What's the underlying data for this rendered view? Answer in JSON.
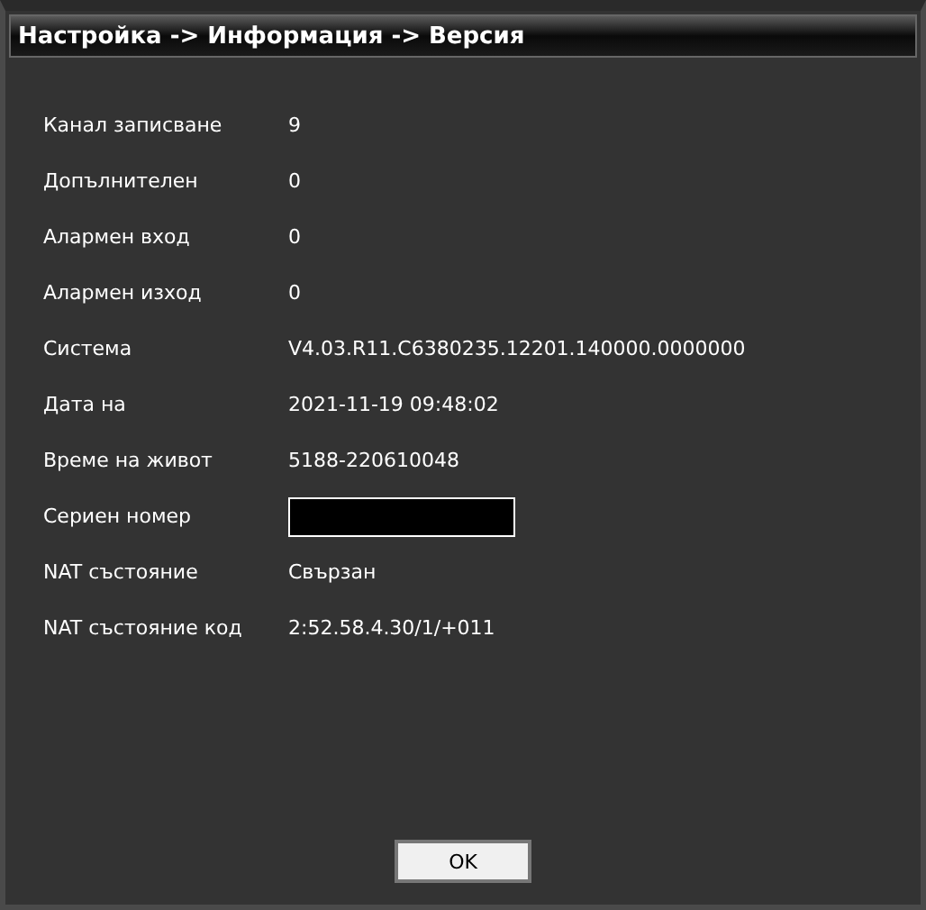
{
  "window": {
    "title": "Настройка -> Информация -> Версия"
  },
  "rows": [
    {
      "label": "Канал записване",
      "kind": "text",
      "value": "9"
    },
    {
      "label": "Допълнителен",
      "kind": "text",
      "value": "0"
    },
    {
      "label": "Алармен вход",
      "kind": "text",
      "value": "0"
    },
    {
      "label": "Алармен изход",
      "kind": "text",
      "value": "0"
    },
    {
      "label": "Система",
      "kind": "text",
      "value": "V4.03.R11.C6380235.12201.140000.0000000"
    },
    {
      "label": "Дата на",
      "kind": "text",
      "value": "2021-11-19 09:48:02"
    },
    {
      "label": "Време на живот",
      "kind": "text",
      "value": "5188-220610048"
    },
    {
      "label": "Сериен номер",
      "kind": "masked"
    },
    {
      "label": "NAT състояние",
      "kind": "text",
      "value": "Свързан"
    },
    {
      "label": "NAT състояние код",
      "kind": "text",
      "value": "2:52.58.4.30/1/+011"
    }
  ],
  "buttons": [
    {
      "label": "OK"
    }
  ]
}
